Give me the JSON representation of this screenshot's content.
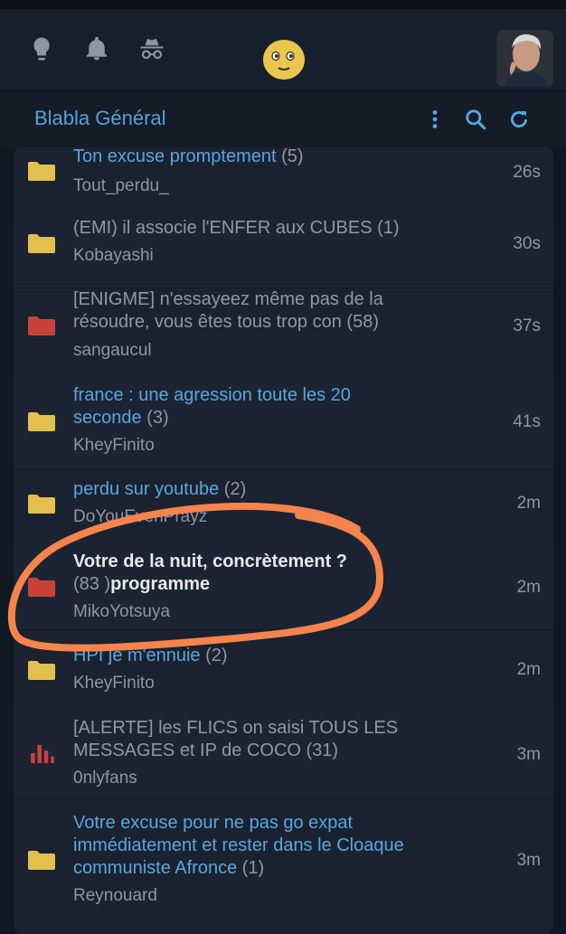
{
  "header": {
    "icons": [
      "lightbulb-icon",
      "bell-icon",
      "incognito-icon",
      "smiley-icon",
      "avatar"
    ],
    "colors": {
      "background": "#161f2c",
      "icon": "#8c96a4",
      "smiley": "#e9c74f"
    }
  },
  "forum": {
    "title": "Blabla Général",
    "actions": [
      "more-vertical-icon",
      "search-icon",
      "refresh-icon"
    ]
  },
  "topics": [
    {
      "title": "Ton excuse promptement",
      "count": "(5)",
      "author": "Tout_perdu_",
      "time": "26s",
      "folder": "yellow",
      "style": "blue"
    },
    {
      "title": "(EMI) il associe l'ENFER aux CUBES",
      "count": "(1)",
      "author": "Kobayashi",
      "time": "30s",
      "folder": "yellow",
      "style": "grey"
    },
    {
      "title_l1": "[ENIGME] n'essayeez même pas de la",
      "title_l2": "résoudre, vous êtes tous trop con",
      "count": "(58)",
      "author": "sangaucul",
      "time": "37s",
      "folder": "red",
      "style": "grey"
    },
    {
      "title_l1": "france : une agression toute les 20",
      "title_l2": "seconde",
      "count": "(3)",
      "author": "KheyFinito",
      "time": "41s",
      "folder": "yellow",
      "style": "blue"
    },
    {
      "title": "perdu sur youtube",
      "count": "(2)",
      "author": "DoYouEvenPrayz",
      "time": "2m",
      "folder": "yellow",
      "style": "blue"
    },
    {
      "title_l1": "Votre de la nuit, concrètement ?",
      "count": "(83 )",
      "title_l2_suffix": "programme",
      "author": "MikoYotsuya",
      "time": "2m",
      "folder": "red",
      "style": "white"
    },
    {
      "title": "HPI je m'ennuie",
      "count": "(2)",
      "author": "KheyFinito",
      "time": "2m",
      "folder": "yellow",
      "style": "blue"
    },
    {
      "title_l1": "[ALERTE] les FLICS on saisi TOUS LES",
      "title_l2": "MESSAGES et IP de COCO",
      "count": "(31)",
      "author": "0nlyfans",
      "time": "3m",
      "folder": "chart",
      "style": "grey"
    },
    {
      "title_l1": "Votre excuse pour ne pas go expat",
      "title_l2": "immédiatement et rester dans le Cloaque",
      "title_l3": "communiste Afronce",
      "count": "(1)",
      "author": "Reynouard",
      "time": "3m",
      "folder": "yellow",
      "style": "blue"
    }
  ],
  "colors": {
    "folder_yellow": "#e3c04d",
    "folder_red": "#c8423a",
    "link_blue": "#5aa6e0",
    "annotation_orange": "#f5844c"
  }
}
